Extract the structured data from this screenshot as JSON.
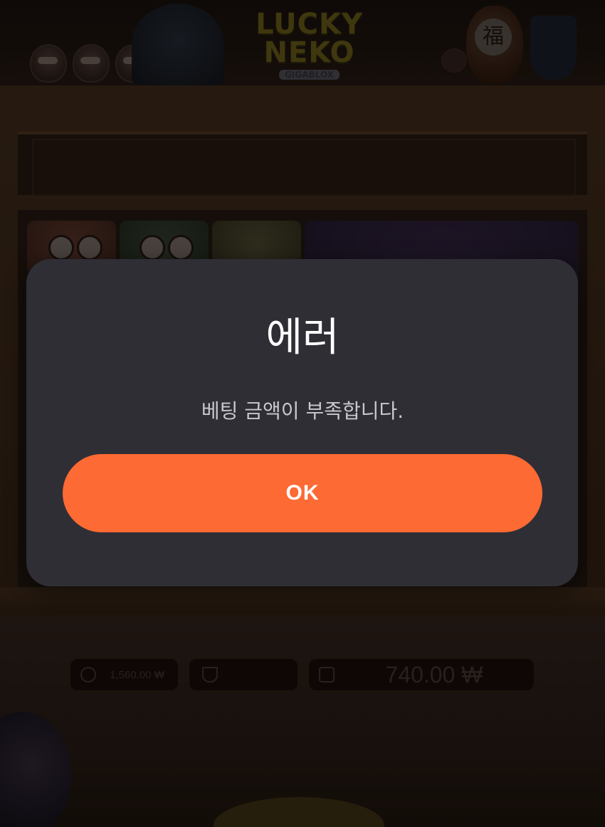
{
  "game": {
    "logo_line1": "LUCKY",
    "logo_line2": "NEKO",
    "logo_badge": "GIGABLOX",
    "fu_glyph": "福"
  },
  "hud": {
    "bet_value": "1,560.00 ₩",
    "win_value": "",
    "balance_value": "740.00 ₩"
  },
  "dialog": {
    "title": "에러",
    "message": "베팅 금액이 부족합니다.",
    "ok_label": "OK"
  },
  "colors": {
    "dialog_bg": "#2f2e35",
    "ok_button": "#fd6a33",
    "title_text": "#ffffff",
    "message_text": "#c9c8cf"
  }
}
